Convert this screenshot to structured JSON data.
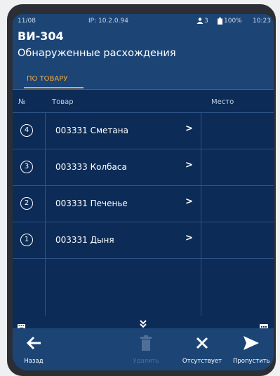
{
  "status_bar": {
    "time_left": "11/08",
    "ip": "IP: 10.2.0.94",
    "users": "3",
    "battery": "100%",
    "time": "10:23"
  },
  "header": {
    "title": "ВИ-304",
    "subtitle": "Обнаруженные расхождения"
  },
  "tabs": [
    {
      "label": "ПО ТОВАРУ",
      "active": true
    }
  ],
  "table": {
    "headers": {
      "num": "№",
      "product": "Товар",
      "place": "Место"
    },
    "rows": [
      {
        "num": "4",
        "product": "003331 Сметана",
        "place": ""
      },
      {
        "num": "3",
        "product": "003333 Колбаса",
        "place": ""
      },
      {
        "num": "2",
        "product": "003331 Печенье",
        "place": ""
      },
      {
        "num": "1",
        "product": "003331 Дыня",
        "place": ""
      }
    ]
  },
  "toolbar": {
    "back_label": "Назад",
    "delete_label": "Удалить",
    "absent_label": "Отсутствует",
    "skip_label": "Пропустить"
  },
  "colors": {
    "screen_bg": "#1c4576",
    "table_bg": "#0c2b57",
    "accent": "#f3a93a"
  },
  "icons": [
    "keyboard-icon",
    "double-chevron-down-icon",
    "keyboard-alt-icon",
    "arrow-left-icon",
    "trash-icon",
    "close-icon",
    "send-icon"
  ]
}
